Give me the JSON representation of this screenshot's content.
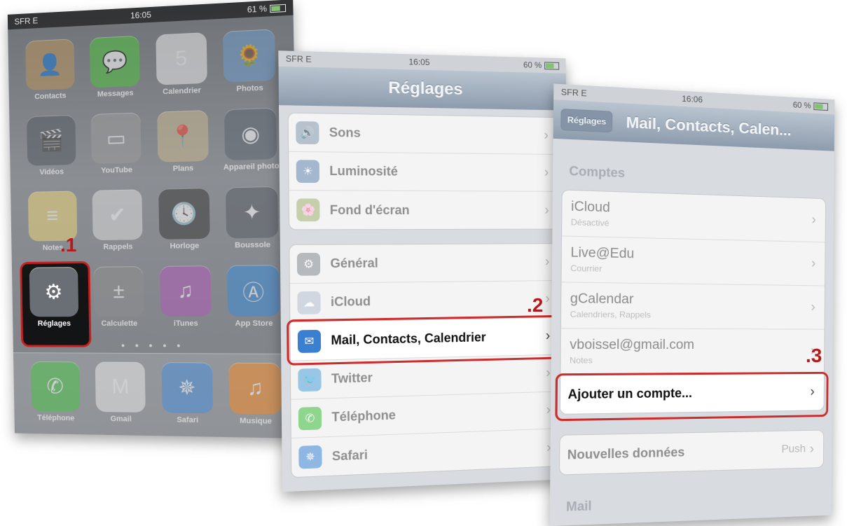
{
  "screen1": {
    "status": {
      "carrier": "SFR E",
      "time": "16:05",
      "battery": "61 %"
    },
    "apps": [
      {
        "label": "Contacts",
        "icon": "contacts-icon",
        "glyph": "👤",
        "color": "#b9925b"
      },
      {
        "label": "Messages",
        "icon": "messages-icon",
        "glyph": "💬",
        "color": "#4fbf3f"
      },
      {
        "label": "Calendrier",
        "icon": "calendar-icon",
        "glyph": "5",
        "color": "#e8e8e8"
      },
      {
        "label": "Photos",
        "icon": "photos-icon",
        "glyph": "🌻",
        "color": "#6e9ac9"
      },
      {
        "label": "Vidéos",
        "icon": "videos-icon",
        "glyph": "🎬",
        "color": "#555b63"
      },
      {
        "label": "YouTube",
        "icon": "youtube-icon",
        "glyph": "▭",
        "color": "#9a9a9a"
      },
      {
        "label": "Plans",
        "icon": "maps-icon",
        "glyph": "📍",
        "color": "#c6b58f"
      },
      {
        "label": "Appareil photo",
        "icon": "camera-icon",
        "glyph": "◉",
        "color": "#5e6670"
      },
      {
        "label": "Notes",
        "icon": "notes-icon",
        "glyph": "≡",
        "color": "#e9d27a"
      },
      {
        "label": "Rappels",
        "icon": "reminders-icon",
        "glyph": "✔",
        "color": "#d9d9d9"
      },
      {
        "label": "Horloge",
        "icon": "clock-icon",
        "glyph": "🕓",
        "color": "#3b3b3b"
      },
      {
        "label": "Boussole",
        "icon": "compass-icon",
        "glyph": "✦",
        "color": "#5a5f66"
      },
      {
        "label": "Réglages",
        "icon": "settings-gear-icon",
        "glyph": "⚙",
        "color": "#6a6f75",
        "active": true
      },
      {
        "label": "Calculette",
        "icon": "calculator-icon",
        "glyph": "±",
        "color": "#8d8d8d"
      },
      {
        "label": "iTunes",
        "icon": "itunes-icon",
        "glyph": "♫",
        "color": "#b05cb8"
      },
      {
        "label": "App Store",
        "icon": "appstore-icon",
        "glyph": "Ⓐ",
        "color": "#3e8ad6"
      }
    ],
    "dock": [
      {
        "label": "Téléphone",
        "icon": "phone-icon",
        "glyph": "✆",
        "color": "#4cc24a"
      },
      {
        "label": "Gmail",
        "icon": "gmail-icon",
        "glyph": "M",
        "color": "#e6e6e6"
      },
      {
        "label": "Safari",
        "icon": "safari-icon",
        "glyph": "✵",
        "color": "#4d8fd9"
      },
      {
        "label": "Musique",
        "icon": "music-icon",
        "glyph": "♫",
        "color": "#f08a2a"
      }
    ],
    "step": ".1"
  },
  "screen2": {
    "status": {
      "carrier": "SFR E",
      "time": "16:05",
      "battery": "60 %"
    },
    "title": "Réglages",
    "group1": [
      {
        "label": "Sons",
        "icon": "sound-icon",
        "glyph": "🔊",
        "color": "#8ea0b5"
      },
      {
        "label": "Luminosité",
        "icon": "brightness-icon",
        "glyph": "☀",
        "color": "#6f8fb8"
      },
      {
        "label": "Fond d'écran",
        "icon": "wallpaper-icon",
        "glyph": "🌸",
        "color": "#a7b77d"
      }
    ],
    "group2": [
      {
        "label": "Général",
        "icon": "general-gear-icon",
        "glyph": "⚙",
        "color": "#8f949a"
      },
      {
        "label": "iCloud",
        "icon": "icloud-icon",
        "glyph": "☁",
        "color": "#b7c4d2"
      },
      {
        "label": "Mail, Contacts, Calendrier",
        "icon": "mail-icon",
        "glyph": "✉",
        "color": "#3b7fd1",
        "highlight": true
      },
      {
        "label": "Twitter",
        "icon": "twitter-icon",
        "glyph": "🐦",
        "color": "#5ea9dd"
      },
      {
        "label": "Téléphone",
        "icon": "phone-icon",
        "glyph": "✆",
        "color": "#4cc24a"
      },
      {
        "label": "Safari",
        "icon": "safari-icon",
        "glyph": "✵",
        "color": "#4d8fd9"
      }
    ],
    "step": ".2"
  },
  "screen3": {
    "status": {
      "carrier": "SFR E",
      "time": "16:06",
      "battery": "60 %"
    },
    "back": "Réglages",
    "title": "Mail, Contacts, Calen...",
    "section_accounts": "Comptes",
    "accounts": [
      {
        "name": "iCloud",
        "sub": "Désactivé"
      },
      {
        "name": "Live@Edu",
        "sub": "Courrier"
      },
      {
        "name": "gCalendar",
        "sub": "Calendriers, Rappels"
      },
      {
        "name": "vboissel@gmail.com",
        "sub": "Notes"
      }
    ],
    "add_account": "Ajouter un compte...",
    "fetch": {
      "label": "Nouvelles données",
      "value": "Push"
    },
    "section_mail": "Mail",
    "step": ".3"
  },
  "colors": {
    "highlight_red": "#c8201f"
  }
}
